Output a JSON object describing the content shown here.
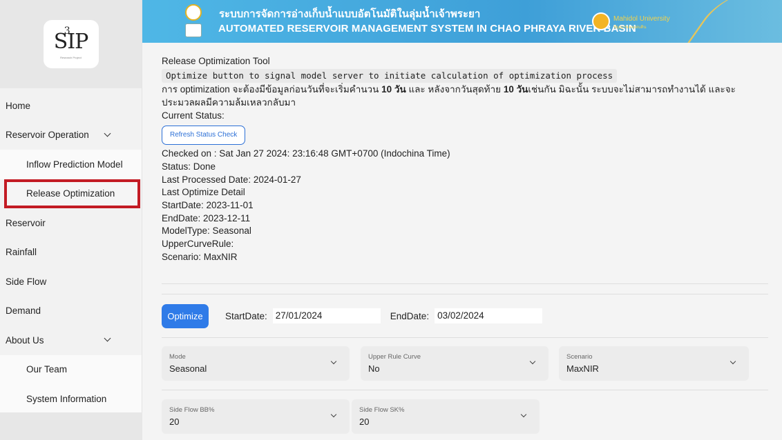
{
  "logo": {
    "text": "SIP",
    "superscript": "3",
    "subtitle": "Research Project"
  },
  "banner": {
    "title_th": "ระบบการจัดการอ่างเก็บน้ำแบบอัตโนมัติในลุ่มน้ำเจ้าพระยา",
    "title_en": "AUTOMATED RESERVOIR MANAGEMENT SYSTEM IN CHAO PHRAYA RIVER BASIN",
    "university": "Mahidol University",
    "university_sub": "ปัญญาของแผ่นดิน"
  },
  "sidebar": {
    "items": [
      {
        "label": "Home"
      },
      {
        "label": "Reservoir Operation"
      },
      {
        "label": "Inflow Prediction Model"
      },
      {
        "label": "Release Optimization"
      },
      {
        "label": "Reservoir"
      },
      {
        "label": "Rainfall"
      },
      {
        "label": "Side Flow"
      },
      {
        "label": "Demand"
      },
      {
        "label": "About Us"
      },
      {
        "label": "Our Team"
      },
      {
        "label": "System Information"
      }
    ]
  },
  "main": {
    "tool_title": "Release Optimization Tool",
    "code_hint": "Optimize button to signal model server to initiate calculation of optimization process",
    "thai_note": {
      "part1": "การ optimization จะต้องมีข้อมูลก่อนวันที่จะเริ่มคำนวน ",
      "bold1": "10 วัน",
      "part2": " และ หลังจากวันสุดท้าย ",
      "bold2": "10 วัน",
      "part3": "เช่นกัน มิฉะนั้น ระบบจะไม่สามารถทำงานได้ และจะประมวลผลมีความล้มเหลวกลับมา"
    },
    "current_status_label": "Current Status:",
    "refresh_button": "Refresh Status Check",
    "checked_on": "Checked on : Sat Jan 27 2024: 23:16:48 GMT+0700 (Indochina Time)",
    "status": "Status: Done",
    "last_processed": "Last Processed Date: 2024-01-27",
    "last_optimize_detail": "Last Optimize Detail",
    "start_date": "StartDate: 2023-11-01",
    "end_date": "EndDate: 2023-12-11",
    "model_type": "ModelType: Seasonal",
    "upper_curve_rule": "UpperCurveRule:",
    "scenario": "Scenario: MaxNIR"
  },
  "form": {
    "optimize_button": "Optimize",
    "start_label": "StartDate:",
    "start_value": "27/01/2024",
    "end_label": "EndDate:",
    "end_value": "03/02/2024",
    "mode": {
      "label": "Mode",
      "value": "Seasonal"
    },
    "upper_rule_curve": {
      "label": "Upper Rule Curve",
      "value": "No"
    },
    "scenario": {
      "label": "Scenario",
      "value": "MaxNIR"
    },
    "side_flow_bb": {
      "label": "Side Flow BB%",
      "value": "20"
    },
    "side_flow_sk": {
      "label": "Side Flow SK%",
      "value": "20"
    }
  },
  "colors": {
    "active_outline": "#c31b24",
    "primary": "#2f7be8",
    "banner": "#3e9fd8"
  }
}
